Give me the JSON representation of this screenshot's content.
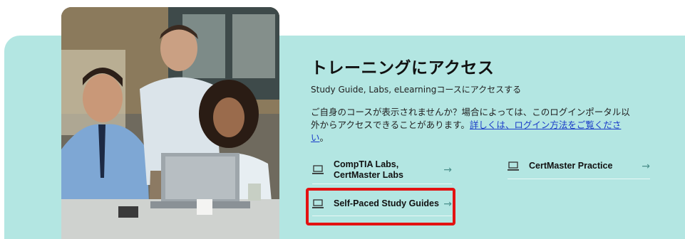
{
  "section": {
    "heading": "トレーニングにアクセス",
    "subtitle": "Study Guide, Labs, eLearningコースにアクセスする",
    "notice_text": "ご自身のコースが表示されませんか？場合によっては、このログインポータル以外からアクセスできることがあります。",
    "notice_link": "詳しくは、ログイン方法をご覧ください",
    "notice_end": "。"
  },
  "links": [
    {
      "line1": "CompTIA Labs,",
      "line2": "CertMaster Labs",
      "arrow": "→"
    },
    {
      "label": "CertMaster Practice",
      "arrow": "→"
    },
    {
      "label": "Self-Paced Study Guides",
      "arrow": "→"
    }
  ],
  "colors": {
    "panel": "#b3e6e2",
    "highlight": "#e31212",
    "link": "#1a3cc8"
  },
  "icons": {
    "link_icon": "laptop-icon",
    "arrow": "arrow-right-icon"
  }
}
